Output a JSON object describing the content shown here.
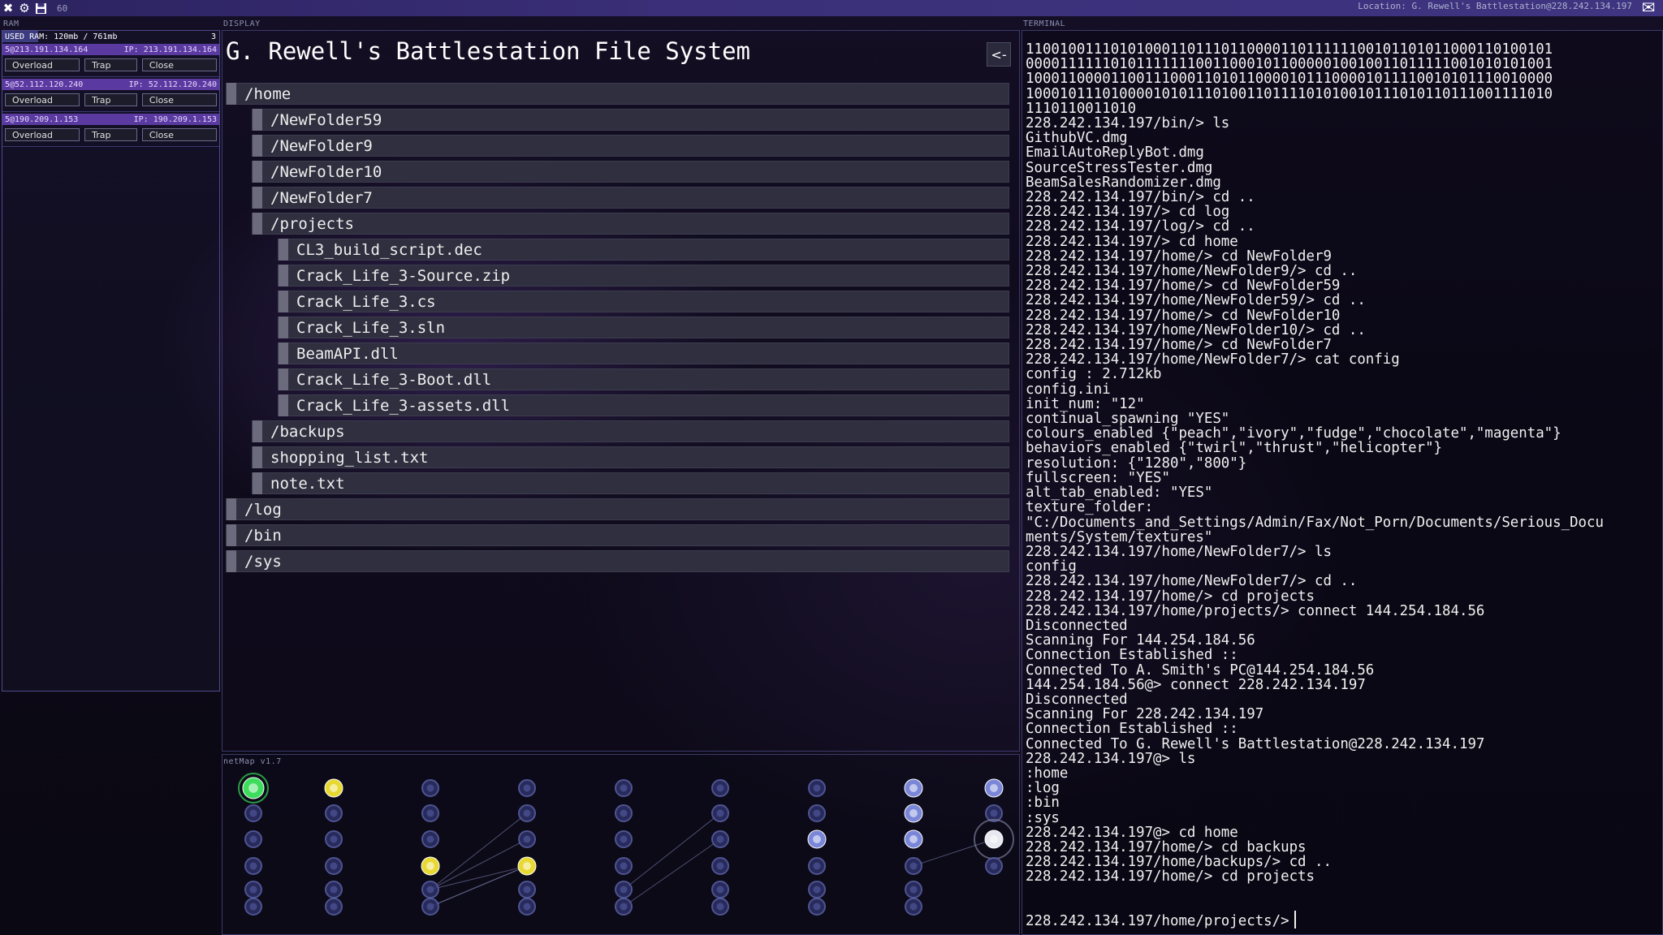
{
  "topbar": {
    "fps": "60",
    "location": "Location: G. Rewell's Battlestation@228.242.134.197"
  },
  "ram": {
    "panel_label": "RAM",
    "used_label": "USED RAM: 120mb / 761mb",
    "process_count": "3",
    "processes": [
      {
        "left": "5@213.191.134.164",
        "right": "IP: 213.191.134.164",
        "buttons": [
          "Overload",
          "Trap",
          "Close"
        ]
      },
      {
        "left": "5@52.112.120.240",
        "right": "IP: 52.112.120.240",
        "buttons": [
          "Overload",
          "Trap",
          "Close"
        ]
      },
      {
        "left": "5@190.209.1.153",
        "right": "IP: 190.209.1.153",
        "buttons": [
          "Overload",
          "Trap",
          "Close"
        ]
      }
    ]
  },
  "display": {
    "panel_label": "DISPLAY",
    "title": "G. Rewell's Battlestation File System",
    "back_label": "<-",
    "tree": [
      {
        "label": "/home",
        "depth": 0
      },
      {
        "label": "/NewFolder59",
        "depth": 1
      },
      {
        "label": "/NewFolder9",
        "depth": 1
      },
      {
        "label": "/NewFolder10",
        "depth": 1
      },
      {
        "label": "/NewFolder7",
        "depth": 1
      },
      {
        "label": "/projects",
        "depth": 1
      },
      {
        "label": "CL3_build_script.dec",
        "depth": 2
      },
      {
        "label": "Crack_Life_3-Source.zip",
        "depth": 2
      },
      {
        "label": "Crack_Life_3.cs",
        "depth": 2
      },
      {
        "label": "Crack_Life_3.sln",
        "depth": 2
      },
      {
        "label": "BeamAPI.dll",
        "depth": 2
      },
      {
        "label": "Crack_Life_3-Boot.dll",
        "depth": 2
      },
      {
        "label": "Crack_Life_3-assets.dll",
        "depth": 2
      },
      {
        "label": "/backups",
        "depth": 1
      },
      {
        "label": "shopping_list.txt",
        "depth": 1
      },
      {
        "label": "note.txt",
        "depth": 1
      },
      {
        "label": "/log",
        "depth": 0
      },
      {
        "label": "/bin",
        "depth": 0
      },
      {
        "label": "/sys",
        "depth": 0
      }
    ]
  },
  "netmap": {
    "panel_label": "netMap v1.7",
    "colors": {
      "node": "#5a62a8",
      "home": "#3ddc5c",
      "visited": "#e8d832",
      "current": "#e8e8f0",
      "highlight": "#7a86d8"
    }
  },
  "terminal": {
    "panel_label": "TERMINAL",
    "lines": [
      "11001001110101000110111011000011011111100101101011000110100101",
      "00001111110101111111001100010110000010010011011111001010101001",
      "10001100001100111000110101100001011100001011110010101110010000",
      "10001011101000010101110100110111101010010111010110111001111010",
      "1110110011010",
      "228.242.134.197/bin/> ls",
      "GithubVC.dmg",
      "EmailAutoReplyBot.dmg",
      "SourceStressTester.dmg",
      "BeamSalesRandomizer.dmg",
      "228.242.134.197/bin/> cd ..",
      "228.242.134.197/> cd log",
      "228.242.134.197/log/> cd ..",
      "228.242.134.197/> cd home",
      "228.242.134.197/home/> cd NewFolder9",
      "228.242.134.197/home/NewFolder9/> cd ..",
      "228.242.134.197/home/> cd NewFolder59",
      "228.242.134.197/home/NewFolder59/> cd ..",
      "228.242.134.197/home/> cd NewFolder10",
      "228.242.134.197/home/NewFolder10/> cd ..",
      "228.242.134.197/home/> cd NewFolder7",
      "228.242.134.197/home/NewFolder7/> cat config",
      "config : 2.712kb",
      "config.ini",
      "init_num: \"12\"",
      "continual_spawning \"YES\"",
      "colours_enabled {\"peach\",\"ivory\",\"fudge\",\"chocolate\",\"magenta\"}",
      "behaviors_enabled {\"twirl\",\"thrust\",\"helicopter\"}",
      "resolution: {\"1280\",\"800\"}",
      "fullscreen: \"YES\"",
      "alt_tab_enabled: \"YES\"",
      "texture_folder:",
      "\"C:/Documents_and_Settings/Admin/Fax/Not_Porn/Documents/Serious_Docu",
      "ments/System/textures\"",
      "228.242.134.197/home/NewFolder7/> ls",
      "config",
      "228.242.134.197/home/NewFolder7/> cd ..",
      "228.242.134.197/home/> cd projects",
      "228.242.134.197/home/projects/> connect 144.254.184.56",
      "Disconnected",
      "Scanning For 144.254.184.56",
      "Connection Established ::",
      "Connected To A. Smith's PC@144.254.184.56",
      "144.254.184.56@> connect 228.242.134.197",
      "Disconnected",
      "Scanning For 228.242.134.197",
      "Connection Established ::",
      "Connected To G. Rewell's Battlestation@228.242.134.197",
      "228.242.134.197@> ls",
      ":home",
      ":log",
      ":bin",
      ":sys",
      "228.242.134.197@> cd home",
      "228.242.134.197/home/> cd backups",
      "228.242.134.197/home/backups/> cd ..",
      "228.242.134.197/home/> cd projects"
    ],
    "prompt": "228.242.134.197/home/projects/>"
  }
}
